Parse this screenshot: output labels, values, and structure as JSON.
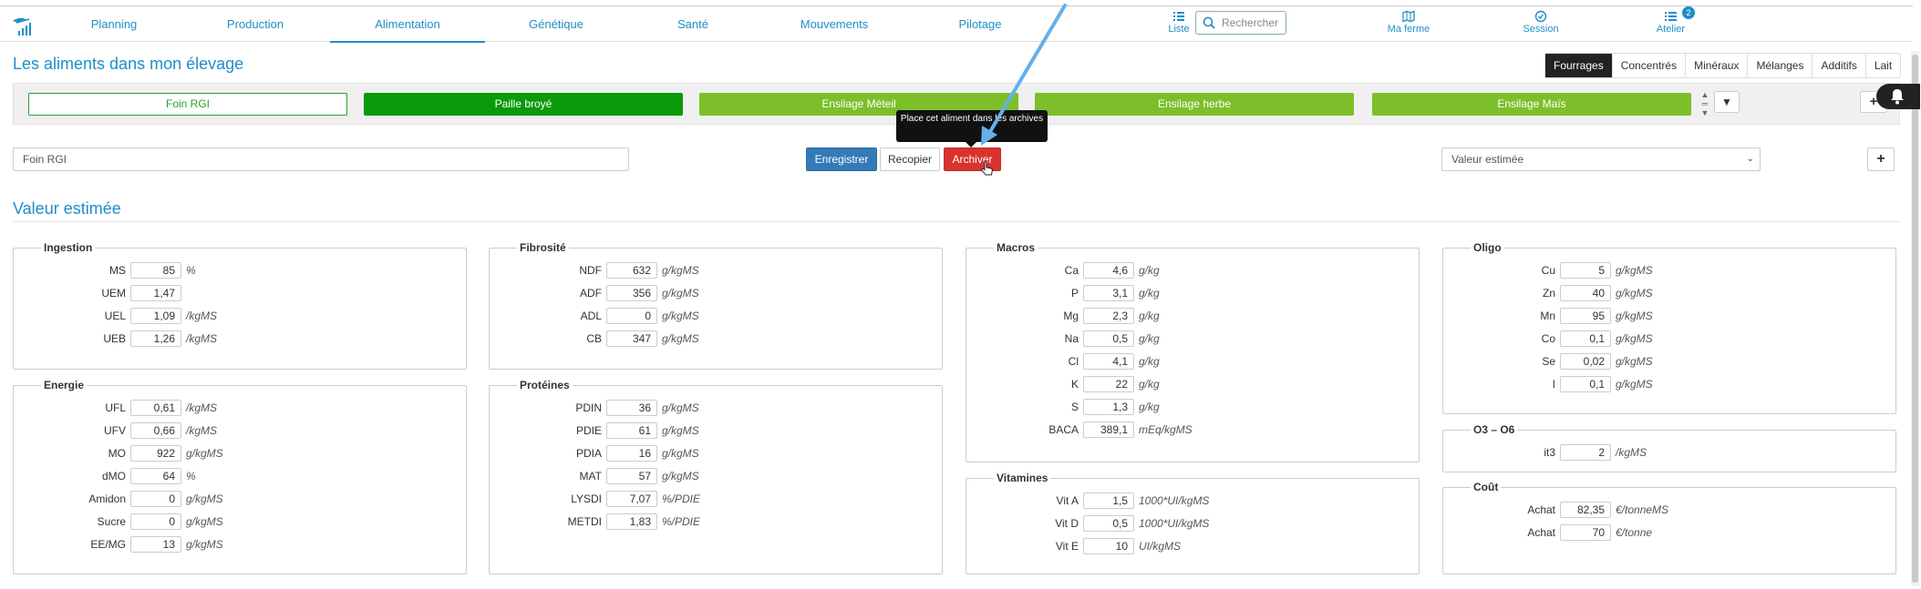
{
  "nav": {
    "tabs": [
      {
        "label": "Planning"
      },
      {
        "label": "Production"
      },
      {
        "label": "Alimentation"
      },
      {
        "label": "Génétique"
      },
      {
        "label": "Santé"
      },
      {
        "label": "Mouvements"
      },
      {
        "label": "Pilotage"
      }
    ],
    "active_tab": "Alimentation",
    "list_label": "Liste",
    "search_placeholder": "Rechercher",
    "farm_label": "Ma ferme",
    "session_label": "Session",
    "workshop_label": "Atelier",
    "workshop_badge": "2"
  },
  "page": {
    "title": "Les aliments dans mon élevage",
    "section_title": "Valeur estimée"
  },
  "categories": [
    {
      "label": "Fourrages"
    },
    {
      "label": "Concentrés"
    },
    {
      "label": "Minéraux"
    },
    {
      "label": "Mélanges"
    },
    {
      "label": "Additifs"
    },
    {
      "label": "Lait"
    }
  ],
  "active_category": "Fourrages",
  "foods": [
    {
      "label": "Foin RGI"
    },
    {
      "label": "Paille broyé"
    },
    {
      "label": "Ensilage Méteil"
    },
    {
      "label": "Ensilage herbe"
    },
    {
      "label": "Ensilage Maïs"
    }
  ],
  "tooltip": {
    "text": "Place cet aliment dans les archives"
  },
  "form": {
    "name_value": "Foin RGI",
    "save_label": "Enregistrer",
    "copy_label": "Recopier",
    "archive_label": "Archiver",
    "value_select": "Valeur estimée",
    "add_label": "+"
  },
  "panels": {
    "ingestion": {
      "title": "Ingestion",
      "rows": [
        {
          "label": "MS",
          "value": "85",
          "unit": "%"
        },
        {
          "label": "UEM",
          "value": "1,47",
          "unit": ""
        },
        {
          "label": "UEL",
          "value": "1,09",
          "unit": "/kgMS"
        },
        {
          "label": "UEB",
          "value": "1,26",
          "unit": "/kgMS"
        }
      ]
    },
    "energie": {
      "title": "Energie",
      "rows": [
        {
          "label": "UFL",
          "value": "0,61",
          "unit": "/kgMS"
        },
        {
          "label": "UFV",
          "value": "0,66",
          "unit": "/kgMS"
        },
        {
          "label": "MO",
          "value": "922",
          "unit": "g/kgMS"
        },
        {
          "label": "dMO",
          "value": "64",
          "unit": "%"
        },
        {
          "label": "Amidon",
          "value": "0",
          "unit": "g/kgMS"
        },
        {
          "label": "Sucre",
          "value": "0",
          "unit": "g/kgMS"
        },
        {
          "label": "EE/MG",
          "value": "13",
          "unit": "g/kgMS"
        }
      ]
    },
    "fibrosite": {
      "title": "Fibrosité",
      "rows": [
        {
          "label": "NDF",
          "value": "632",
          "unit": "g/kgMS"
        },
        {
          "label": "ADF",
          "value": "356",
          "unit": "g/kgMS"
        },
        {
          "label": "ADL",
          "value": "0",
          "unit": "g/kgMS"
        },
        {
          "label": "CB",
          "value": "347",
          "unit": "g/kgMS"
        }
      ]
    },
    "proteines": {
      "title": "Protéines",
      "rows": [
        {
          "label": "PDIN",
          "value": "36",
          "unit": "g/kgMS"
        },
        {
          "label": "PDIE",
          "value": "61",
          "unit": "g/kgMS"
        },
        {
          "label": "PDIA",
          "value": "16",
          "unit": "g/kgMS"
        },
        {
          "label": "MAT",
          "value": "57",
          "unit": "g/kgMS"
        },
        {
          "label": "LYSDI",
          "value": "7,07",
          "unit": "%/PDIE"
        },
        {
          "label": "METDI",
          "value": "1,83",
          "unit": "%/PDIE"
        }
      ]
    },
    "macros": {
      "title": "Macros",
      "rows": [
        {
          "label": "Ca",
          "value": "4,6",
          "unit": "g/kg"
        },
        {
          "label": "P",
          "value": "3,1",
          "unit": "g/kg"
        },
        {
          "label": "Mg",
          "value": "2,3",
          "unit": "g/kg"
        },
        {
          "label": "Na",
          "value": "0,5",
          "unit": "g/kg"
        },
        {
          "label": "Cl",
          "value": "4,1",
          "unit": "g/kg"
        },
        {
          "label": "K",
          "value": "22",
          "unit": "g/kg"
        },
        {
          "label": "S",
          "value": "1,3",
          "unit": "g/kg"
        },
        {
          "label": "BACA",
          "value": "389,1",
          "unit": "mEq/kgMS"
        }
      ]
    },
    "vitamines": {
      "title": "Vitamines",
      "rows": [
        {
          "label": "Vit A",
          "value": "1,5",
          "unit": "1000*UI/kgMS"
        },
        {
          "label": "Vit D",
          "value": "0,5",
          "unit": "1000*UI/kgMS"
        },
        {
          "label": "Vit E",
          "value": "10",
          "unit": "UI/kgMS"
        }
      ]
    },
    "oligo": {
      "title": "Oligo",
      "rows": [
        {
          "label": "Cu",
          "value": "5",
          "unit": "g/kgMS"
        },
        {
          "label": "Zn",
          "value": "40",
          "unit": "g/kgMS"
        },
        {
          "label": "Mn",
          "value": "95",
          "unit": "g/kgMS"
        },
        {
          "label": "Co",
          "value": "0,1",
          "unit": "g/kgMS"
        },
        {
          "label": "Se",
          "value": "0,02",
          "unit": "g/kgMS"
        },
        {
          "label": "I",
          "value": "0,1",
          "unit": "g/kgMS"
        }
      ]
    },
    "o3o6": {
      "title": "O3 – O6",
      "rows": [
        {
          "label": "it3",
          "value": "2",
          "unit": "/kgMS"
        }
      ]
    },
    "cout": {
      "title": "Coût",
      "rows": [
        {
          "label": "Achat",
          "value": "82,35",
          "unit": "€/tonneMS"
        },
        {
          "label": "Achat",
          "value": "70",
          "unit": "€/tonne"
        }
      ]
    }
  },
  "colors": {
    "brand": "#1e8ec8",
    "archive": "#d9332e",
    "save": "#337ab7",
    "food_dark": "#0a9a0a",
    "food_light": "#7cbf2a",
    "annotation_arrow": "#64b0ec"
  }
}
